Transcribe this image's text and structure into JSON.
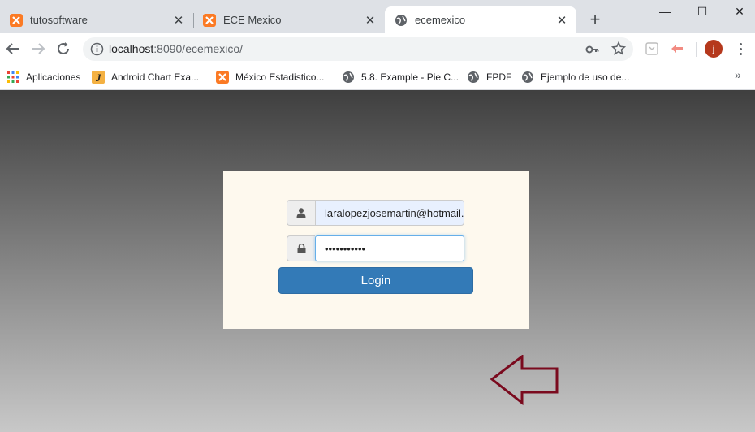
{
  "tabs": [
    {
      "title": "tutosoftware",
      "icon": "xampp-icon",
      "active": false
    },
    {
      "title": "ECE Mexico",
      "icon": "xampp-icon",
      "active": false
    },
    {
      "title": "ecemexico",
      "icon": "globe-icon",
      "active": true
    }
  ],
  "window_controls": {
    "minimize": "—",
    "maximize": "☐",
    "close": "✕"
  },
  "address": {
    "host": "localhost",
    "rest": ":8090/ecemexico/"
  },
  "user_initial": "j",
  "bookmarks": [
    {
      "label": "Aplicaciones",
      "icon": "apps-grid-icon"
    },
    {
      "label": "Android Chart Exa...",
      "icon": "java-j-icon"
    },
    {
      "label": "México Estadistico...",
      "icon": "xampp-icon"
    },
    {
      "label": "5.8. Example - Pie C...",
      "icon": "globe-icon"
    },
    {
      "label": "FPDF",
      "icon": "globe-icon"
    },
    {
      "label": "Ejemplo de uso de...",
      "icon": "globe-icon"
    }
  ],
  "bookmarks_more": "»",
  "login": {
    "email_value": "laralopezjosemartin@hotmail.",
    "password_value": "•••••••••••",
    "button_label": "Login"
  },
  "colors": {
    "primary_button": "#337ab7",
    "arrow_stroke": "#7a0a1e",
    "panel_bg": "#fef9ee",
    "xampp_orange": "#fb7a24"
  }
}
